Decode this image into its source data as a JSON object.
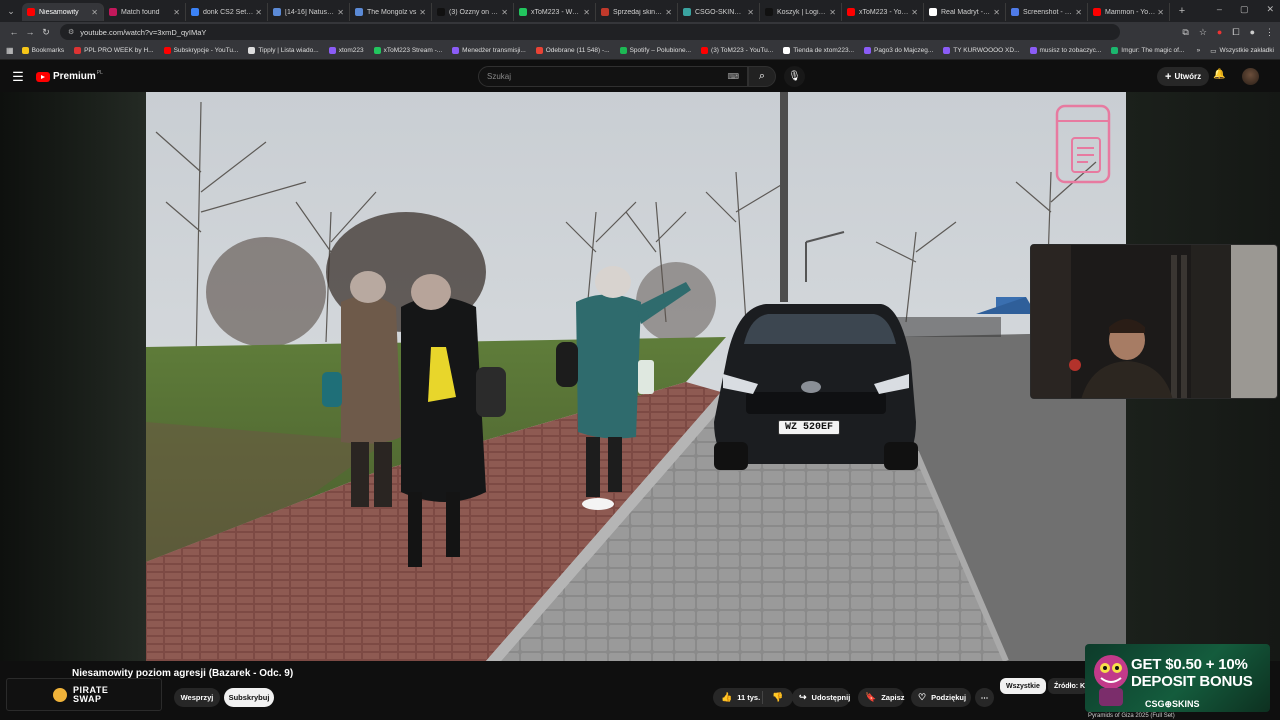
{
  "browser": {
    "tabs": [
      {
        "title": "Niesamowity",
        "color": "#ff0000",
        "active": true
      },
      {
        "title": "Match found",
        "color": "#c2185b"
      },
      {
        "title": "donk CS2 Settings",
        "color": "#3b82f6"
      },
      {
        "title": "[14-16] Natus Vi...",
        "color": "#5b8ad6"
      },
      {
        "title": "The Mongolz vs",
        "color": "#5b8ad6"
      },
      {
        "title": "(3) Ozzny on X: \"...",
        "color": "#111111"
      },
      {
        "title": "xToM223 - Watch",
        "color": "#22c55e"
      },
      {
        "title": "Sprzedaj skiny C...",
        "color": "#c0392b"
      },
      {
        "title": "CSGO-SKINS.COM",
        "color": "#3aa3a0"
      },
      {
        "title": "Koszyk | Logitech",
        "color": "#111111"
      },
      {
        "title": "xToM223 - YouTu...",
        "color": "#ff0000"
      },
      {
        "title": "Real Madryt - Ra...",
        "color": "#ffffff"
      },
      {
        "title": "Screenshot - 44...",
        "color": "#4f7be8"
      },
      {
        "title": "Mammon - YouT...",
        "color": "#ff0000"
      }
    ],
    "url": "youtube.com/watch?v=3xmD_qyIMaY",
    "bookmarks": [
      {
        "label": "Bookmarks",
        "color": "#f5c518"
      },
      {
        "label": "PPL PRO WEEK by H...",
        "color": "#d33"
      },
      {
        "label": "Subskrypcje - YouTu...",
        "color": "#ff0000"
      },
      {
        "label": "Tipply | Lista wiado...",
        "color": "#ddd"
      },
      {
        "label": "xtom223",
        "color": "#8b5cf6"
      },
      {
        "label": "xToM223 Stream -...",
        "color": "#22c55e"
      },
      {
        "label": "Menedżer transmisji...",
        "color": "#8b5cf6"
      },
      {
        "label": "Odebrane (11 548) -...",
        "color": "#ea4335"
      },
      {
        "label": "Spotify – Polubione...",
        "color": "#1db954"
      },
      {
        "label": "(3) ToM223 - YouTu...",
        "color": "#ff0000"
      },
      {
        "label": "Tienda de xtom223...",
        "color": "#fff"
      },
      {
        "label": "Pago3 do Majczeg...",
        "color": "#8b5cf6"
      },
      {
        "label": "TY KURWOOOO XD...",
        "color": "#8b5cf6"
      },
      {
        "label": "musisz to zobaczyc...",
        "color": "#8b5cf6"
      },
      {
        "label": "Imgur: The magic of...",
        "color": "#1bb76e"
      }
    ],
    "bookmarks_all": "Wszystkie zakładki"
  },
  "youtube": {
    "logo_text": "Premium",
    "logo_region": "PL",
    "search_placeholder": "Szukaj",
    "create_label": "Utwórz",
    "video_title": "Niesamowity poziom agresji (Bazarek - Odc. 9)",
    "channel_logo_text": "PIRATE SWAP",
    "support_label": "Wesprzyj",
    "subscribe_label": "Subskrybuj",
    "like_count": "11 tys.",
    "share_label": "Udostępnij",
    "save_label": "Zapisz",
    "thanks_label": "Podziękuj",
    "chip_all": "Wszystkie",
    "chip_source": "Źródło: Ko"
  },
  "video": {
    "plate_text": "WZ 520EF"
  },
  "ad": {
    "line1": "GET $0.50 + 10%",
    "line2": "DEPOSIT BONUS",
    "brand": "CSG⊕SKINS",
    "caption": "Pyramids of Giza 2025 (Full Set)"
  }
}
